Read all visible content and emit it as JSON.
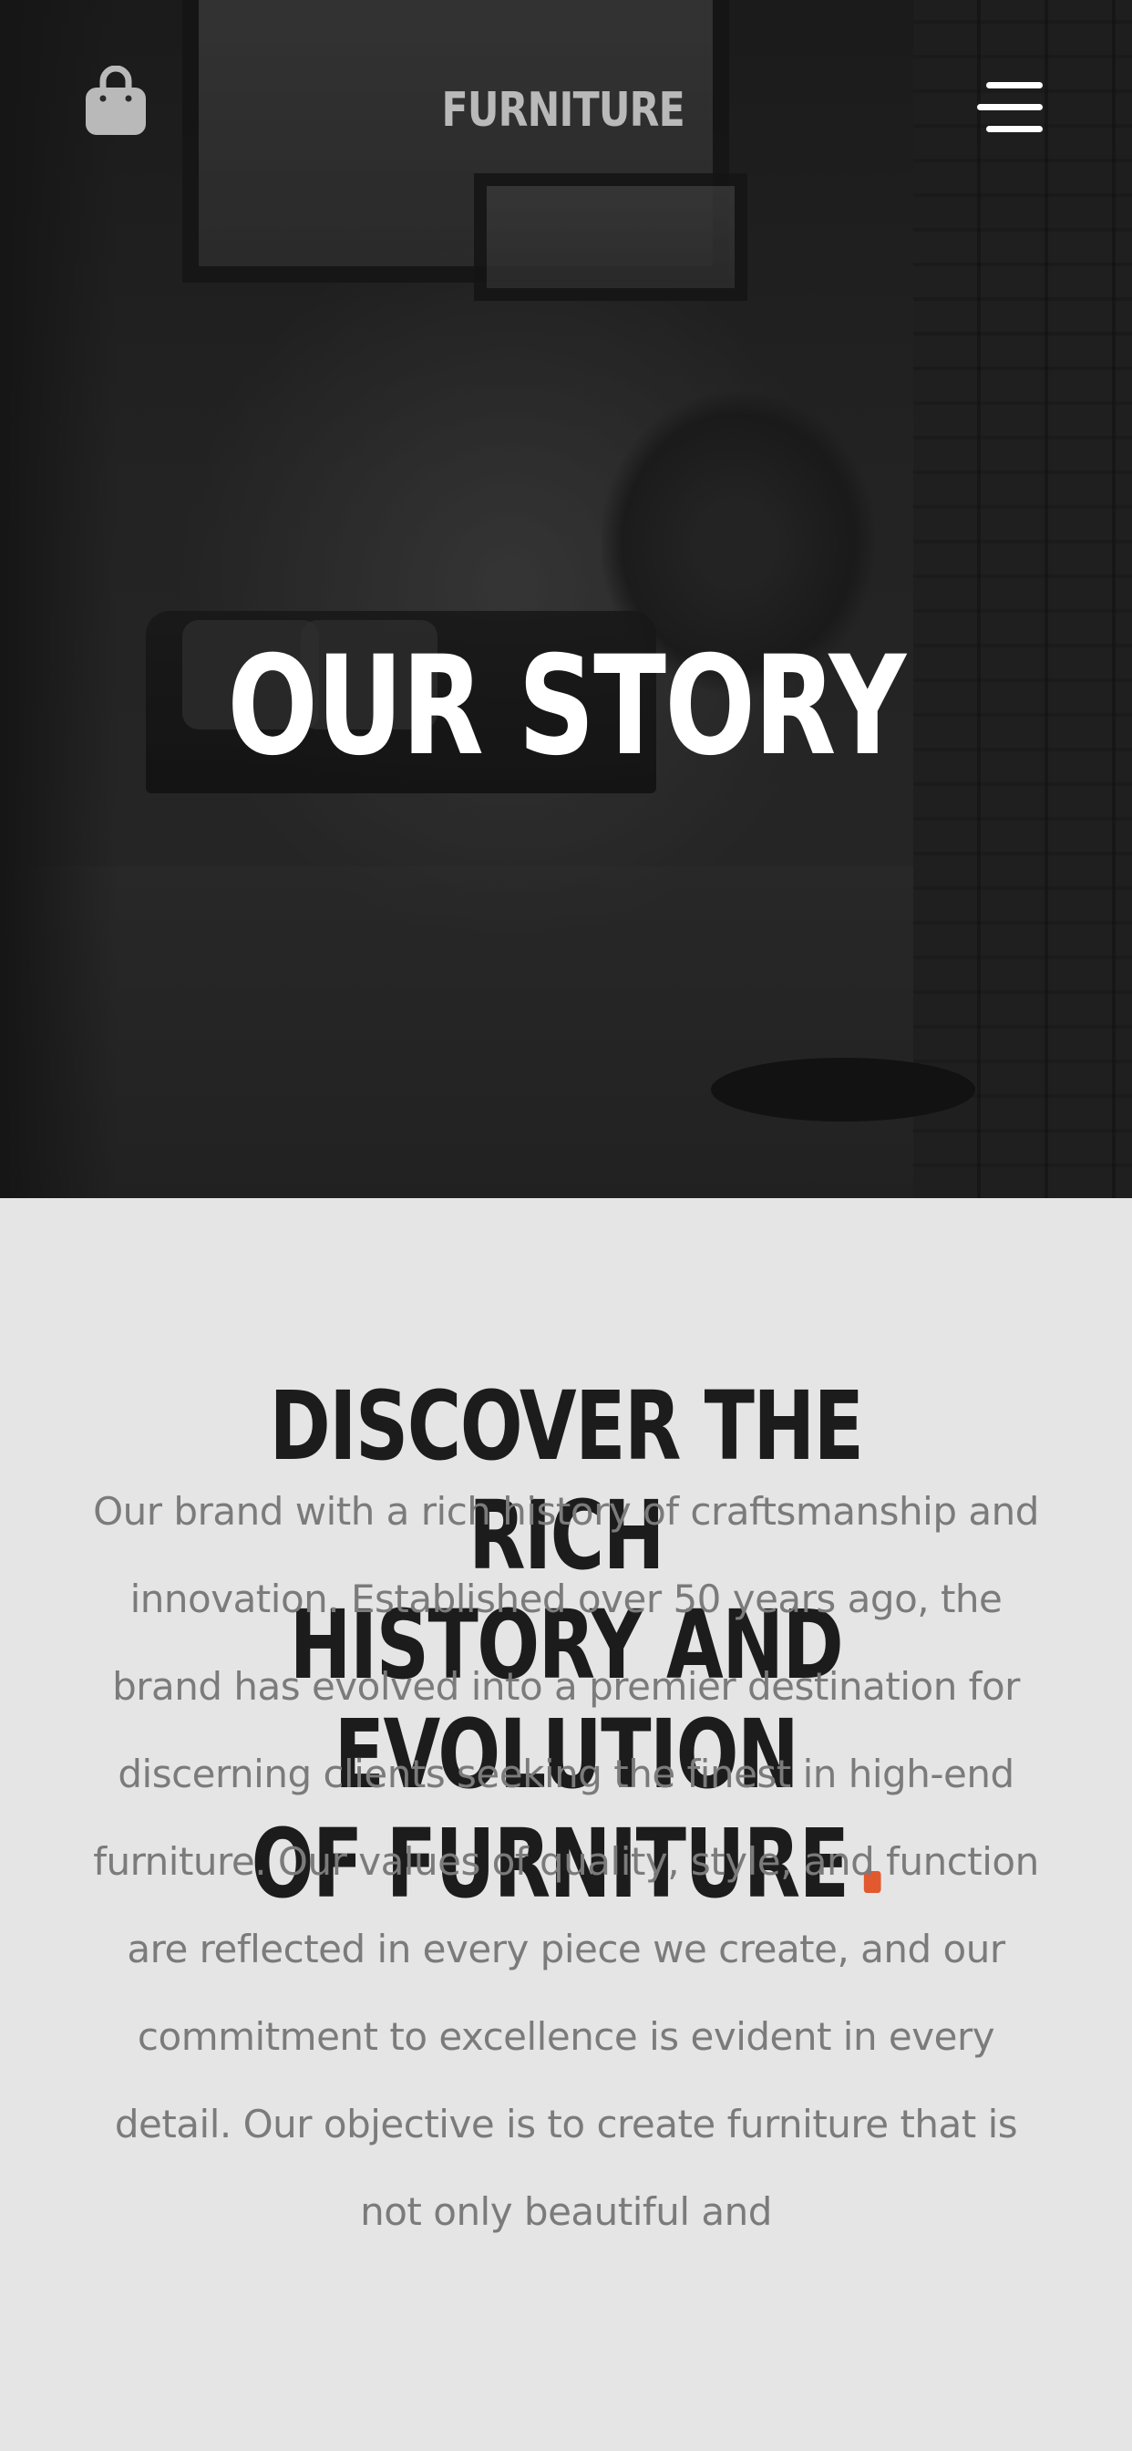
{
  "header": {
    "brand": "FURNITURE",
    "cart_icon": "shopping-bag-icon",
    "menu_icon": "hamburger-menu-icon"
  },
  "hero": {
    "title": "OUR STORY"
  },
  "story": {
    "heading_line1": "DISCOVER THE RICH",
    "heading_line2": "HISTORY AND EVOLUTION",
    "heading_line3": "OF FURNITURE",
    "body": "Our brand with a rich history of craftsmanship and innovation. Established over 50 years ago, the brand has evolved into a premier destination for discerning clients seeking the finest in high-end furniture. Our values of quality, style, and function are reflected in every piece we create, and our commitment to excellence is evident in every detail. Our objective is to create furniture that is not only beautiful and"
  },
  "colors": {
    "accent": "#e2582f",
    "hero_bg": "#262626",
    "page_bg": "#e6e5e6",
    "heading": "#1c1c1c",
    "body_text": "#7c7b7c"
  }
}
